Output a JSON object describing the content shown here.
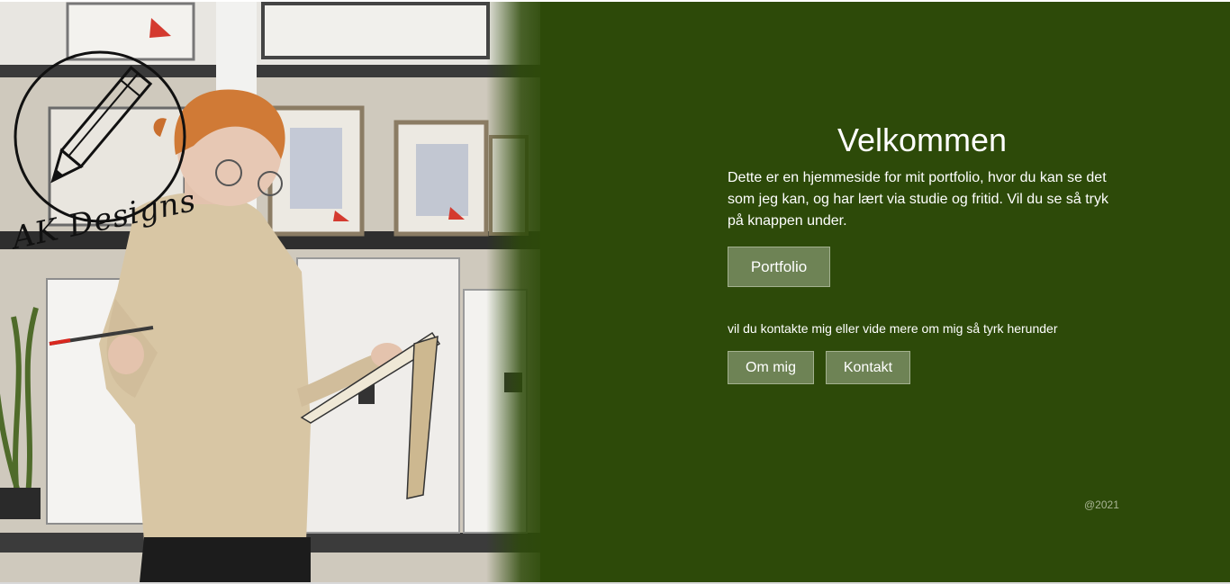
{
  "logo": {
    "text": "AK Designs",
    "icon": "pencil-circle-icon"
  },
  "hero": {
    "title": "Velkommen",
    "intro": "Dette er en hjemmeside for mit portfolio, hvor du kan se det som jeg kan, og har lært via studie og fritid. Vil du se så tryk på knappen under.",
    "portfolio_button": "Portfolio",
    "contact_text": "vil du kontakte mig eller vide mere om mig så tyrk herunder",
    "about_button": "Om mig",
    "contact_button": "Kontakt"
  },
  "footer": {
    "copyright": "@2021"
  },
  "colors": {
    "background": "#2d4a09",
    "button": "#6e8355",
    "button_border": "#a3b18f",
    "copyright": "#a9b595"
  }
}
